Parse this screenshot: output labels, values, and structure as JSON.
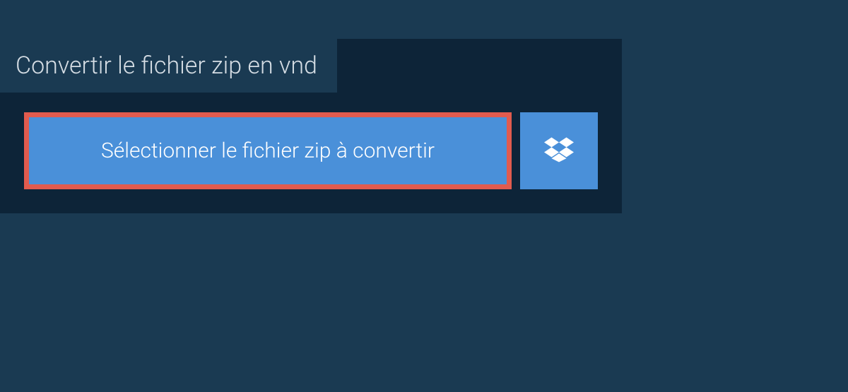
{
  "converter": {
    "title": "Convertir le fichier zip en vnd",
    "select_button_label": "Sélectionner le fichier zip à convertir"
  }
}
